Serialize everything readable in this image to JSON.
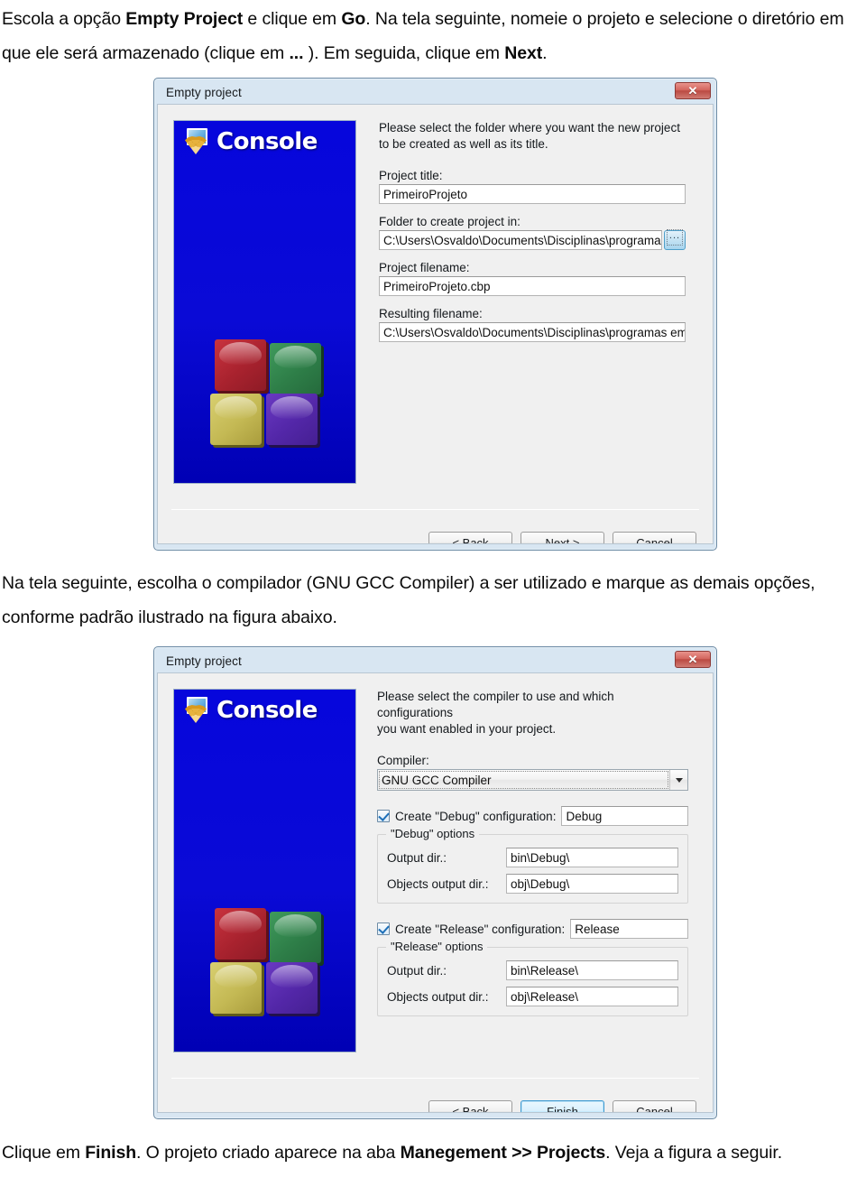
{
  "document": {
    "paragraph_top_html": "Escola a op&ccedil;&atilde;o <b>Empty Project</b> e clique em <b>Go</b>. Na tela seguinte, nomeie o projeto e selecione o diret&oacute;rio em que ele ser&aacute; armazenado (clique em <b>...</b> ). Em seguida, clique em <b>Next</b>.",
    "paragraph_mid_html": "Na tela seguinte, escolha o compilador (GNU GCC Compiler) a ser utilizado e marque as demais op&ccedil;&otilde;es, conforme padr&atilde;o ilustrado na figura abaixo.",
    "paragraph_bottom_html": "Clique em <b>Finish</b>. O projeto criado aparece na aba <b>Manegement &gt;&gt; Projects</b>. Veja a figura a seguir."
  },
  "dialog1": {
    "title": "Empty project",
    "close_glyph": "✕",
    "banner": {
      "word": "Console"
    },
    "intro_line1": "Please select the folder where you want the new project",
    "intro_line2": "to be created as well as its title.",
    "fields": [
      {
        "label": "Project title:",
        "value": "PrimeiroProjeto"
      },
      {
        "label": "Folder to create project in:",
        "value": "C:\\Users\\Osvaldo\\Documents\\Disciplinas\\programas"
      },
      {
        "label": "Project filename:",
        "value": "PrimeiroProjeto.cbp"
      },
      {
        "label": "Resulting filename:",
        "value": "C:\\Users\\Osvaldo\\Documents\\Disciplinas\\programas em"
      }
    ],
    "browse_dots": "...",
    "buttons": [
      {
        "pre": "< ",
        "key": "B",
        "post": "ack",
        "default": false
      },
      {
        "pre": "",
        "key": "N",
        "post": "ext >",
        "default": false
      },
      {
        "pre": "",
        "key": "C",
        "post": "ancel",
        "default": false
      }
    ]
  },
  "dialog2": {
    "title": "Empty project",
    "close_glyph": "✕",
    "banner": {
      "word": "Console"
    },
    "intro_line1": "Please select the compiler to use and which configurations",
    "intro_line2": "you want enabled in your project.",
    "compiler_label": "Compiler:",
    "compiler_value": "GNU GCC Compiler",
    "debug": {
      "checkbox_label": "Create \"Debug\" configuration:",
      "checked": true,
      "config_name": "Debug",
      "group_title": "\"Debug\" options",
      "rows": [
        {
          "label": "Output dir.:",
          "value": "bin\\Debug\\"
        },
        {
          "label": "Objects output dir.:",
          "value": "obj\\Debug\\"
        }
      ]
    },
    "release": {
      "checkbox_label": "Create \"Release\" configuration:",
      "checked": true,
      "config_name": "Release",
      "group_title": "\"Release\" options",
      "rows": [
        {
          "label": "Output dir.:",
          "value": "bin\\Release\\"
        },
        {
          "label": "Objects output dir.:",
          "value": "obj\\Release\\"
        }
      ]
    },
    "buttons": [
      {
        "pre": "< ",
        "key": "B",
        "post": "ack",
        "default": false
      },
      {
        "pre": "",
        "key": "F",
        "post": "inish",
        "default": true
      },
      {
        "pre": "",
        "key": "C",
        "post": "ancel",
        "default": false
      }
    ]
  },
  "colors": {
    "dialog_frame": "#d8e6f2",
    "dialog_body": "#f0f0f0",
    "banner_blue": "#0000d0",
    "close_red": "#bb4a42",
    "accent_blue": "#3c9ad1"
  }
}
